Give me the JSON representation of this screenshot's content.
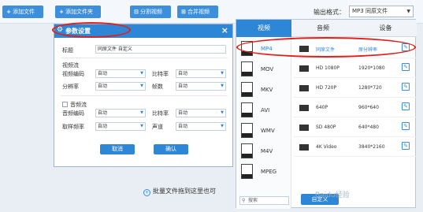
{
  "toolbar": {
    "add_file": "添加文件",
    "add_folder": "添加文件夹",
    "split_video": "分割视频",
    "merge_video": "合并视频",
    "output_format_label": "输出格式：",
    "output_format_value": "MP3 同原文件"
  },
  "workspace": {
    "drop_hint": "批量文件拖到这里也可"
  },
  "dialog": {
    "title": "参数设置",
    "title_label": "标题",
    "title_value": "同原文件 自定义",
    "video_section": "视频流",
    "video_codec_label": "视频编码",
    "video_codec_value": "自动",
    "bitrate_label": "比特率",
    "bitrate_value": "自动",
    "resolution_label": "分辨率",
    "resolution_value": "自动",
    "framerate_label": "帧数",
    "framerate_value": "自动",
    "audio_section": "音频流",
    "audio_codec_label": "音频编码",
    "audio_codec_value": "自动",
    "audio_bitrate_label": "比特率",
    "audio_bitrate_value": "自动",
    "sample_rate_label": "取样频率",
    "sample_rate_value": "自动",
    "channel_label": "声道",
    "channel_value": "自动",
    "cancel": "取消",
    "confirm": "确认"
  },
  "panel": {
    "tabs": [
      "视频",
      "音频",
      "设备"
    ],
    "formats": [
      "MP4",
      "MOV",
      "MKV",
      "AVI",
      "WMV",
      "M4V",
      "MPEG"
    ],
    "search_placeholder": "搜索",
    "qualities": [
      {
        "name": "同原文件",
        "res": "原分辨率"
      },
      {
        "name": "HD 1080P",
        "res": "1920*1080"
      },
      {
        "name": "HD 720P",
        "res": "1280*720"
      },
      {
        "name": "640P",
        "res": "960*640"
      },
      {
        "name": "SD 480P",
        "res": "640*480"
      },
      {
        "name": "4K Video",
        "res": "3840*2160"
      }
    ],
    "custom_button": "自定义",
    "watermark": "Baidu经验"
  },
  "colors": {
    "accent": "#2e86d6",
    "annotation": "#e0201b"
  },
  "icons": {
    "add": "plus-icon",
    "split": "split-icon",
    "merge": "merge-icon",
    "settings": "gear-icon",
    "close": "close-icon",
    "file": "file-format-icon",
    "film": "film-icon",
    "edit": "edit-icon",
    "search": "search-icon"
  }
}
